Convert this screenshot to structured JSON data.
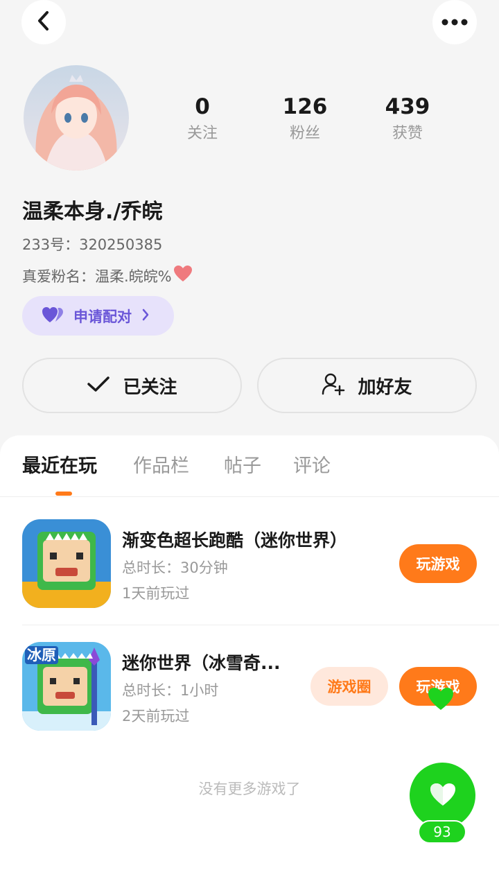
{
  "profile": {
    "username": "温柔本身./乔皖",
    "uid": "233号：320250385",
    "fan_name": "真爱粉名：温柔.皖皖%",
    "stats": [
      {
        "value": "0",
        "label": "关注"
      },
      {
        "value": "126",
        "label": "粉丝"
      },
      {
        "value": "439",
        "label": "获赞"
      }
    ]
  },
  "pair_button": {
    "label": "申请配对"
  },
  "actions": {
    "follow_label": "已关注",
    "add_friend_label": "加好友"
  },
  "tabs": [
    {
      "label": "最近在玩",
      "active": true
    },
    {
      "label": "作品栏",
      "active": false
    },
    {
      "label": "帖子",
      "active": false
    },
    {
      "label": "评论",
      "active": false
    }
  ],
  "games": [
    {
      "title": "渐变色超长跑酷（迷你世界）",
      "duration": "总时长：30分钟",
      "last_played": "1天前玩过",
      "play_label": "玩游戏"
    },
    {
      "title": "迷你世界（冰雪奇...",
      "icon_badge": "冰原",
      "duration": "总时长：1小时",
      "last_played": "2天前玩过",
      "circle_label": "游戏圈",
      "play_label": "玩游戏"
    }
  ],
  "no_more_text": "没有更多游戏了",
  "likes": {
    "count": "93"
  },
  "colors": {
    "accent": "#ff7a1a",
    "pair_purple": "#6a56d8",
    "like_green": "#1ed21e"
  }
}
